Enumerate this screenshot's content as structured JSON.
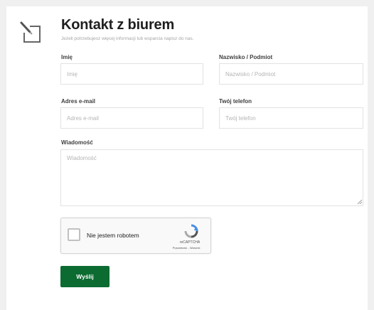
{
  "form": {
    "title": "Kontakt z biurem",
    "subtitle": "Jeżeli potrzebujesz więcej informacji lub wsparcia napisz do nas.",
    "corner_icon": "pencil-edit-icon",
    "first_name": {
      "label": "Imię",
      "placeholder": "Imię",
      "value": ""
    },
    "last_name": {
      "label": "Nazwisko / Podmiot",
      "placeholder": "Nazwisko / Podmiot",
      "value": ""
    },
    "email": {
      "label": "Adres e-mail",
      "placeholder": "Adres e-mail",
      "value": ""
    },
    "phone": {
      "label": "Twój telefon",
      "placeholder": "Twój telefon",
      "value": ""
    },
    "message": {
      "label": "Wiadomość",
      "placeholder": "Wiadomość",
      "value": ""
    },
    "submit_label": "Wyślij"
  },
  "captcha": {
    "label": "Nie jestem robotem",
    "brand": "reCAPTCHA",
    "terms": "Prywatność - Warunki",
    "checked": false,
    "icon": "recaptcha-logo-icon"
  },
  "colors": {
    "accent": "#0b6b31",
    "page_background": "#f0f0f0",
    "card_background": "#ffffff"
  }
}
